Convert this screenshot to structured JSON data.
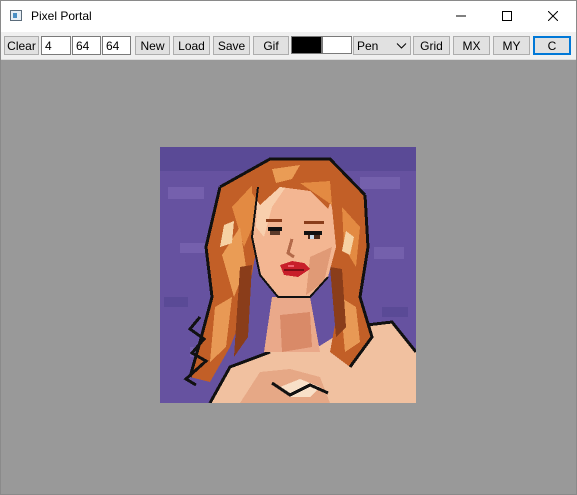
{
  "window": {
    "title": "Pixel Portal",
    "minimize_icon": "minimize-icon",
    "maximize_icon": "maximize-icon",
    "close_icon": "close-icon"
  },
  "toolbar": {
    "clear_label": "Clear",
    "brush_size": "4",
    "width": "64",
    "height": "64",
    "new_label": "New",
    "load_label": "Load",
    "save_label": "Save",
    "gif_label": "Gif",
    "primary_color": "#000000",
    "secondary_color": "#ffffff",
    "tool_selected": "Pen",
    "grid_label": "Grid",
    "mx_label": "MX",
    "my_label": "MY",
    "c_label": "C"
  },
  "canvas": {
    "background_color": "#999999",
    "image_description": "pixel-art-portrait"
  }
}
